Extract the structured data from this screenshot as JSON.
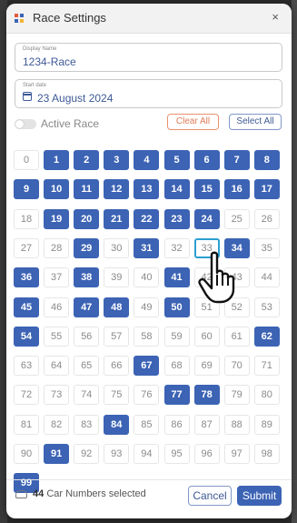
{
  "window": {
    "title": "Race Settings",
    "close_symbol": "×"
  },
  "display_name": {
    "label": "Display Name",
    "value": "1234-Race"
  },
  "start_date": {
    "label": "Start date",
    "value": "23 August 2024"
  },
  "active_race": {
    "label": "Active Race",
    "enabled": false
  },
  "buttons": {
    "clear_all": "Clear All",
    "select_all": "Select All",
    "cancel": "Cancel",
    "submit": "Submit"
  },
  "car_numbers": {
    "min": 0,
    "max": 99,
    "selected": [
      1,
      2,
      3,
      4,
      5,
      6,
      7,
      8,
      9,
      10,
      11,
      12,
      13,
      14,
      15,
      16,
      17,
      19,
      20,
      21,
      22,
      23,
      24,
      29,
      31,
      34,
      36,
      38,
      41,
      45,
      47,
      48,
      50,
      54,
      62,
      67,
      77,
      78,
      84,
      91,
      99
    ],
    "hovered": 33
  },
  "selection_summary": {
    "count": "44",
    "text": "Car Numbers selected"
  },
  "colors": {
    "accent": "#3c63b4",
    "clear_accent": "#e07a55",
    "hover_outline": "#2c9fd0"
  },
  "icons": {
    "title": "app-logo-icon",
    "date": "calendar-icon",
    "summary": "car-icon",
    "pointer": "hand-pointer-icon"
  }
}
